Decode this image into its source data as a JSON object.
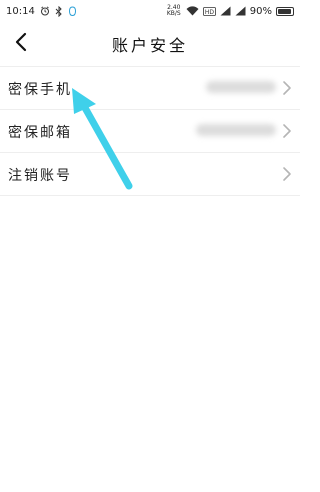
{
  "status_bar": {
    "time": "10:14",
    "network_speed_top": "2.40",
    "network_speed_bottom": "KB/S",
    "sim_badge": "HD",
    "battery_percent": "90%",
    "battery_level": 0.9,
    "icons": [
      "alarm-icon",
      "bluetooth-icon",
      "notification-icon",
      "wifi-icon",
      "hd-icon",
      "signal-icon",
      "battery-icon"
    ]
  },
  "header": {
    "back_icon": "chevron-left-icon",
    "title": "账户安全"
  },
  "list": {
    "items": [
      {
        "label": "密保手机",
        "value": "",
        "value_blurred": true
      },
      {
        "label": "密保邮箱",
        "value": "",
        "value_blurred": true
      },
      {
        "label": "注销账号",
        "value": "",
        "value_blurred": false
      }
    ]
  },
  "annotation": {
    "color": "#3fd0ea",
    "icon": "arrow-annotation"
  },
  "colors": {
    "background": "#ffffff",
    "divider": "#eeeeee",
    "chevron": "#b5b5b5",
    "text": "#222222"
  }
}
